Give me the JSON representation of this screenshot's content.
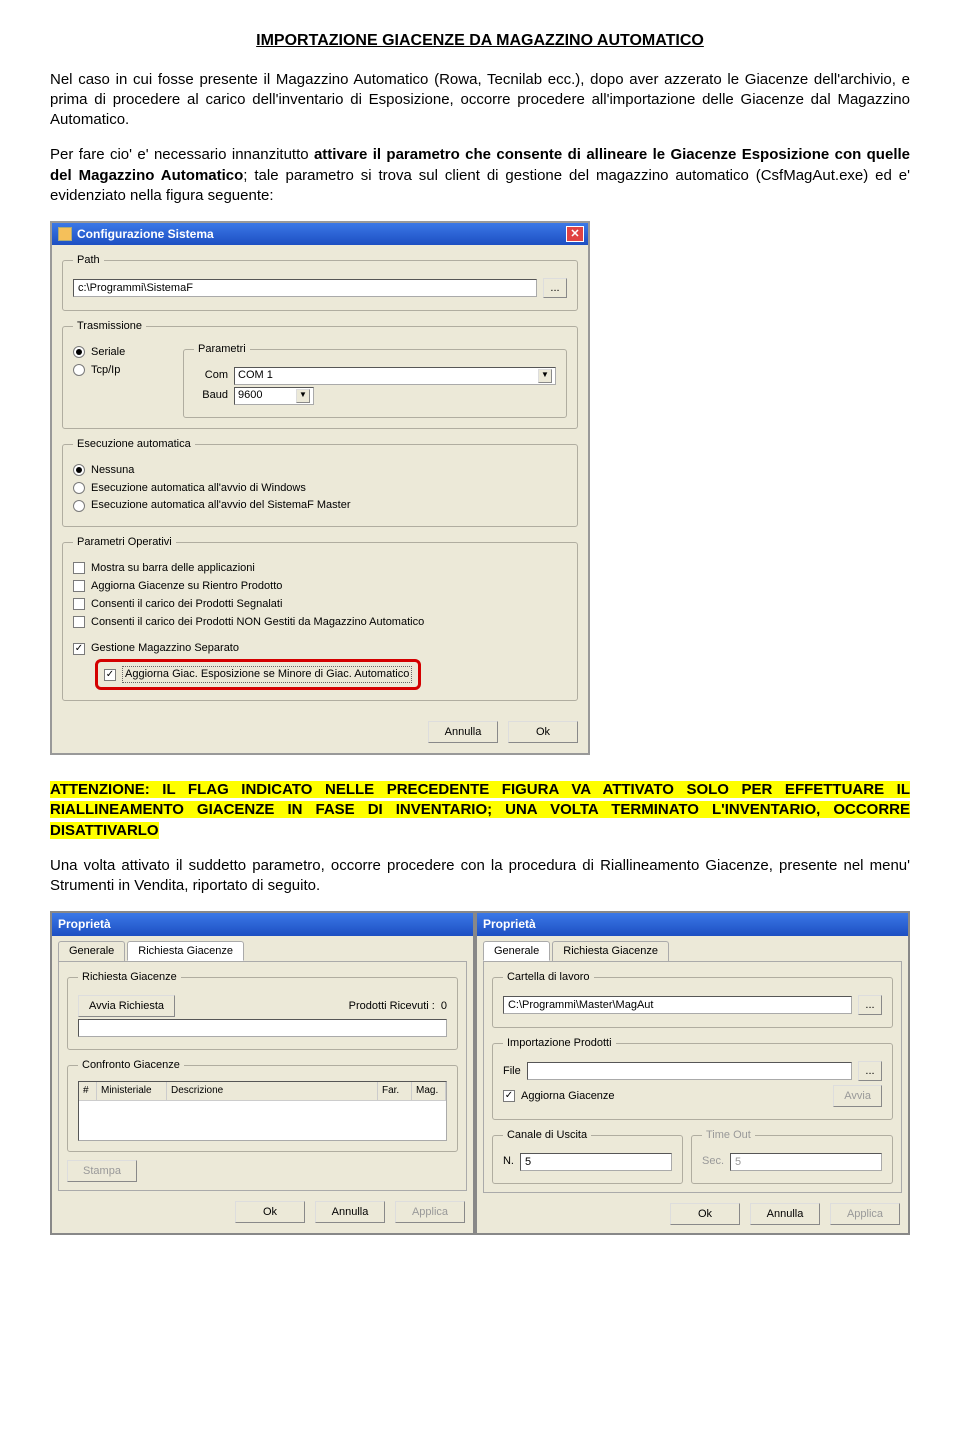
{
  "doc": {
    "title": "IMPORTAZIONE GIACENZE DA MAGAZZINO AUTOMATICO",
    "p1": "Nel caso in cui fosse presente il Magazzino Automatico (Rowa, Tecnilab ecc.), dopo aver azzerato le Giacenze dell'archivio, e prima di procedere al carico dell'inventario di Esposizione, occorre procedere all'importazione delle Giacenze dal Magazzino Automatico.",
    "p2a": "Per fare cio' e' necessario innanzitutto ",
    "p2b": "attivare il parametro che consente di allineare le Giacenze Esposizione con quelle del Magazzino Automatico",
    "p2c": "; tale parametro si trova sul client di gestione del magazzino automatico (CsfMagAut.exe) ed e' evidenziato nella figura seguente:",
    "attn": "ATTENZIONE: IL FLAG INDICATO NELLE PRECEDENTE FIGURA VA ATTIVATO SOLO PER EFFETTUARE IL RIALLINEAMENTO GIACENZE IN FASE DI INVENTARIO; UNA VOLTA TERMINATO L'INVENTARIO, OCCORRE DISATTIVARLO",
    "p3": "Una volta attivato il suddetto parametro, occorre procedere con la procedura di Riallineamento Giacenze, presente nel menu' Strumenti in Vendita, riportato di seguito."
  },
  "dlg1": {
    "title": "Configurazione Sistema",
    "path_legend": "Path",
    "path_value": "c:\\Programmi\\SistemaF",
    "browse": "...",
    "trasm_legend": "Trasmissione",
    "seriale": "Seriale",
    "tcpip": "Tcp/Ip",
    "param_legend": "Parametri",
    "com_label": "Com",
    "com_value": "COM 1",
    "baud_label": "Baud",
    "baud_value": "9600",
    "exec_legend": "Esecuzione automatica",
    "exec_none": "Nessuna",
    "exec_win": "Esecuzione automatica all'avvio di Windows",
    "exec_master": "Esecuzione automatica all'avvio del SistemaF Master",
    "op_legend": "Parametri Operativi",
    "op1": "Mostra su barra delle applicazioni",
    "op2": "Aggiorna Giacenze su Rientro Prodotto",
    "op3": "Consenti il carico dei Prodotti Segnalati",
    "op4": "Consenti il carico dei Prodotti NON Gestiti da Magazzino Automatico",
    "op5": "Gestione Magazzino Separato",
    "op6": "Aggiorna Giac. Esposizione se Minore di Giac. Automatico",
    "annulla": "Annulla",
    "ok": "Ok"
  },
  "prop": {
    "title": "Proprietà",
    "tab_gen": "Generale",
    "tab_rich": "Richiesta Giacenze",
    "rich_legend": "Richiesta Giacenze",
    "prod_ricevuti_lbl": "Prodotti Ricevuti :",
    "prod_ricevuti_val": "0",
    "avvia": "Avvia Richiesta",
    "confronto_legend": "Confronto Giacenze",
    "col_hash": "#",
    "col_min": "Ministeriale",
    "col_desc": "Descrizione",
    "col_far": "Far.",
    "col_mag": "Mag.",
    "stampa": "Stampa",
    "ok": "Ok",
    "annulla": "Annulla",
    "applica": "Applica",
    "cartella_legend": "Cartella di lavoro",
    "cartella_val": "C:\\Programmi\\Master\\MagAut",
    "import_legend": "Importazione Prodotti",
    "file_lbl": "File",
    "aggcheck": "Aggiorna Giacenze",
    "avvia2": "Avvia",
    "canale_legend": "Canale di Uscita",
    "n_lbl": "N.",
    "n_val": "5",
    "timeout_legend": "Time Out",
    "sec_lbl": "Sec.",
    "sec_val": "5"
  }
}
